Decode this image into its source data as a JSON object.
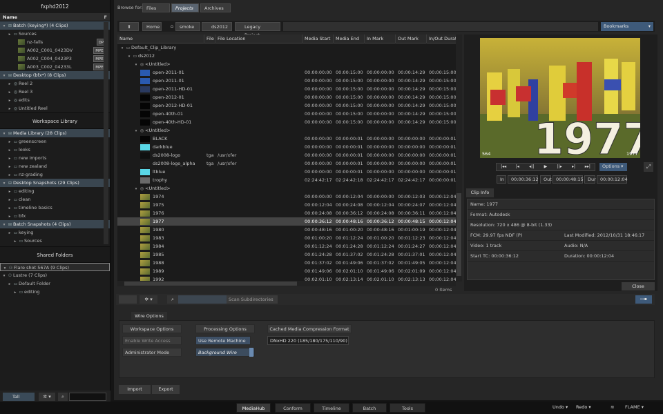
{
  "left": {
    "title": "fxphd2012",
    "col_header": "Name",
    "col_filter": "F",
    "tree": [
      {
        "indent": 0,
        "type": "grp",
        "icon": "batch-icon",
        "label": "Batch (keying*) (4 Clips)"
      },
      {
        "indent": 2,
        "type": "folder",
        "label": "Sources"
      },
      {
        "indent": 4,
        "type": "clip",
        "label": "nz-falls",
        "fmt": "DPX"
      },
      {
        "indent": 4,
        "type": "clip",
        "label": "A002_C001_0423DV",
        "fmt": "MPEG"
      },
      {
        "indent": 4,
        "type": "clip",
        "label": "A002_C004_0423P3",
        "fmt": "MPEG"
      },
      {
        "indent": 4,
        "type": "clip",
        "label": "A003_C002_04233L",
        "fmt": "MPEG"
      },
      {
        "indent": 0,
        "type": "grp",
        "icon": "desktop-icon",
        "label": "Desktop (bfx*) (8 Clips)"
      },
      {
        "indent": 2,
        "type": "reel",
        "label": "Reel 2"
      },
      {
        "indent": 2,
        "type": "reel",
        "label": "Reel 3"
      },
      {
        "indent": 2,
        "type": "reel",
        "label": "edits"
      },
      {
        "indent": 2,
        "type": "reel",
        "label": "Untitled Reel"
      }
    ],
    "section_workspace": "Workspace Library",
    "tree2": [
      {
        "indent": 0,
        "type": "grp",
        "label": "Media Library (28 Clips)"
      },
      {
        "indent": 2,
        "type": "folder",
        "label": "greenscreen"
      },
      {
        "indent": 2,
        "type": "folder",
        "label": "looks"
      },
      {
        "indent": 2,
        "type": "folder",
        "label": "new imports"
      },
      {
        "indent": 2,
        "type": "folder",
        "label": "new zealand"
      },
      {
        "indent": 2,
        "type": "folder",
        "label": "nz-grading"
      },
      {
        "indent": 0,
        "type": "grp",
        "label": "Desktop Snapshots (29 Clips)"
      },
      {
        "indent": 2,
        "type": "folder",
        "label": "editing"
      },
      {
        "indent": 2,
        "type": "folder",
        "label": "clean"
      },
      {
        "indent": 2,
        "type": "folder",
        "label": "timeline basics"
      },
      {
        "indent": 2,
        "type": "folder",
        "label": "bfx"
      },
      {
        "indent": 0,
        "type": "grp",
        "label": "Batch Snapshots (4 Clips)"
      },
      {
        "indent": 2,
        "type": "folder",
        "label": "keying"
      },
      {
        "indent": 4,
        "type": "folder",
        "label": "Sources"
      }
    ],
    "section_shared": "Shared Folders",
    "tree3": [
      {
        "indent": 0,
        "type": "share",
        "label": "Flare shot 567A (9 Clips)",
        "outlined": true
      },
      {
        "indent": 0,
        "type": "share",
        "label": "Lustre (7 Clips)"
      },
      {
        "indent": 2,
        "type": "folder",
        "label": "Default Folder"
      },
      {
        "indent": 4,
        "type": "folder",
        "label": "editing"
      }
    ],
    "bottom": {
      "view_label": "Tall"
    }
  },
  "topbar": {
    "browse_for": "Browse for:",
    "tabs": [
      "Files",
      "Projects",
      "Archives"
    ],
    "active_tab": 1,
    "home": "Home",
    "crumbs": [
      "smoke",
      "ds2012",
      "Legacy Project"
    ],
    "bookmarks": "Bookmarks"
  },
  "table": {
    "columns": [
      "Name",
      "File",
      "File Location",
      "Media Start",
      "Media End",
      "In Mark",
      "Out Mark",
      "In/Out Durati"
    ],
    "rows": [
      {
        "lvl": 0,
        "kind": "lib",
        "name": "Default_Clip_Library"
      },
      {
        "lvl": 1,
        "kind": "lib",
        "name": "ds2012"
      },
      {
        "lvl": 2,
        "kind": "reel",
        "name": "<Untitled>"
      },
      {
        "lvl": 3,
        "kind": "clip",
        "thumb": "blue",
        "name": "open-2011-01",
        "ms": "00:00:00:00",
        "me": "00:00:15:00",
        "in": "00:00:00:00",
        "out": "00:00:14:29",
        "dur": "00:00:15:00"
      },
      {
        "lvl": 3,
        "kind": "clip",
        "thumb": "blue",
        "name": "open-2011-01",
        "ms": "00:00:00:00",
        "me": "00:00:15:00",
        "in": "00:00:00:00",
        "out": "00:00:14:29",
        "dur": "00:00:15:00"
      },
      {
        "lvl": 3,
        "kind": "clip",
        "thumb": "bluegrey",
        "name": "open-2011-HD-01",
        "ms": "00:00:00:00",
        "me": "00:00:15:00",
        "in": "00:00:00:00",
        "out": "00:00:14:29",
        "dur": "00:00:15:00"
      },
      {
        "lvl": 3,
        "kind": "clip",
        "thumb": "black",
        "name": "open-2012-01",
        "ms": "00:00:00:00",
        "me": "00:00:15:00",
        "in": "00:00:00:00",
        "out": "00:00:14:29",
        "dur": "00:00:15:00"
      },
      {
        "lvl": 3,
        "kind": "clip",
        "thumb": "black",
        "name": "open-2012-HD-01",
        "ms": "00:00:00:00",
        "me": "00:00:15:00",
        "in": "00:00:00:00",
        "out": "00:00:14:29",
        "dur": "00:00:15:00"
      },
      {
        "lvl": 3,
        "kind": "clip",
        "thumb": "black",
        "name": "open-40th-01",
        "ms": "00:00:00:00",
        "me": "00:00:15:00",
        "in": "00:00:00:00",
        "out": "00:00:14:29",
        "dur": "00:00:15:00"
      },
      {
        "lvl": 3,
        "kind": "clip",
        "thumb": "black",
        "name": "open-40th-HD-01",
        "ms": "00:00:00:00",
        "me": "00:00:15:00",
        "in": "00:00:00:00",
        "out": "00:00:14:29",
        "dur": "00:00:15:00"
      },
      {
        "lvl": 2,
        "kind": "reel",
        "name": "<Untitled>"
      },
      {
        "lvl": 3,
        "kind": "clip",
        "thumb": "black",
        "name": "BLACK",
        "ms": "00:00:00:00",
        "me": "00:00:00:01",
        "in": "00:00:00:00",
        "out": "00:00:00:00",
        "dur": "00:00:00:01"
      },
      {
        "lvl": 3,
        "kind": "clip",
        "thumb": "cyan",
        "name": "darkblue",
        "ms": "00:00:00:00",
        "me": "00:00:00:01",
        "in": "00:00:00:00",
        "out": "00:00:00:00",
        "dur": "00:00:00:01"
      },
      {
        "lvl": 3,
        "kind": "clip",
        "thumb": "logo",
        "name": "ds2008-logo",
        "file": "tga",
        "loc": "/usr/xfer",
        "ms": "00:00:00:00",
        "me": "00:00:00:01",
        "in": "00:00:00:00",
        "out": "00:00:00:00",
        "dur": "00:00:00:01"
      },
      {
        "lvl": 3,
        "kind": "clip",
        "thumb": "logo2",
        "name": "ds2008-logo_alpha",
        "file": "tga",
        "loc": "/usr/xfer",
        "ms": "00:00:00:00",
        "me": "00:00:00:01",
        "in": "00:00:00:00",
        "out": "00:00:00:00",
        "dur": "00:00:00:01"
      },
      {
        "lvl": 3,
        "kind": "clip",
        "thumb": "cyan",
        "name": "ltblue",
        "ms": "00:00:00:00",
        "me": "00:00:00:01",
        "in": "00:00:00:00",
        "out": "00:00:00:00",
        "dur": "00:00:00:01"
      },
      {
        "lvl": 3,
        "kind": "clip",
        "thumb": "grey",
        "name": "trophy",
        "ms": "02:24:42:17",
        "me": "02:24:42:18",
        "in": "02:24:42:17",
        "out": "02:24:42:17",
        "dur": "00:00:00:01"
      },
      {
        "lvl": 2,
        "kind": "reel",
        "name": "<Untitled>"
      },
      {
        "lvl": 3,
        "kind": "clip",
        "thumb": "photo",
        "name": "1974",
        "ms": "00:00:00:00",
        "me": "00:00:12:04",
        "in": "00:00:00:00",
        "out": "00:00:12:03",
        "dur": "00:00:12:04"
      },
      {
        "lvl": 3,
        "kind": "clip",
        "thumb": "photo",
        "name": "1975",
        "ms": "00:00:12:04",
        "me": "00:00:24:08",
        "in": "00:00:12:04",
        "out": "00:00:24:07",
        "dur": "00:00:12:04"
      },
      {
        "lvl": 3,
        "kind": "clip",
        "thumb": "photo",
        "name": "1976",
        "ms": "00:00:24:08",
        "me": "00:00:36:12",
        "in": "00:00:24:08",
        "out": "00:00:36:11",
        "dur": "00:00:12:04"
      },
      {
        "lvl": 3,
        "kind": "clip",
        "thumb": "photo",
        "name": "1977",
        "ms": "00:00:36:12",
        "me": "00:00:48:16",
        "in": "00:00:36:12",
        "out": "00:00:48:15",
        "dur": "00:00:12:04",
        "sel": true
      },
      {
        "lvl": 3,
        "kind": "clip",
        "thumb": "photo",
        "name": "1980",
        "ms": "00:00:48:16",
        "me": "00:01:00:20",
        "in": "00:00:48:16",
        "out": "00:01:00:19",
        "dur": "00:00:12:04"
      },
      {
        "lvl": 3,
        "kind": "clip",
        "thumb": "photo",
        "name": "1983",
        "ms": "00:01:00:20",
        "me": "00:01:12:24",
        "in": "00:01:00:20",
        "out": "00:01:12:23",
        "dur": "00:00:12:04"
      },
      {
        "lvl": 3,
        "kind": "clip",
        "thumb": "photo",
        "name": "1984",
        "ms": "00:01:12:24",
        "me": "00:01:24:28",
        "in": "00:01:12:24",
        "out": "00:01:24:27",
        "dur": "00:00:12:04"
      },
      {
        "lvl": 3,
        "kind": "clip",
        "thumb": "photo",
        "name": "1985",
        "ms": "00:01:24:28",
        "me": "00:01:37:02",
        "in": "00:01:24:28",
        "out": "00:01:37:01",
        "dur": "00:00:12:04"
      },
      {
        "lvl": 3,
        "kind": "clip",
        "thumb": "photo",
        "name": "1988",
        "ms": "00:01:37:02",
        "me": "00:01:49:06",
        "in": "00:01:37:02",
        "out": "00:01:49:05",
        "dur": "00:00:12:04"
      },
      {
        "lvl": 3,
        "kind": "clip",
        "thumb": "photo",
        "name": "1989",
        "ms": "00:01:49:06",
        "me": "00:02:01:10",
        "in": "00:01:49:06",
        "out": "00:02:01:09",
        "dur": "00:00:12:04"
      },
      {
        "lvl": 3,
        "kind": "clip",
        "thumb": "photo",
        "name": "1992",
        "ms": "00:02:01:10",
        "me": "00:02:13:14",
        "in": "00:02:01:10",
        "out": "00:02:13:13",
        "dur": "00:00:12:04"
      }
    ],
    "items_count": "0 Items"
  },
  "viewer": {
    "overlay_text": "1977",
    "corner_left": "564",
    "corner_right": "1977",
    "options": "Options",
    "in_label": "In",
    "in_val": "00:00:36:12",
    "out_label": "Out",
    "out_val": "00:00:48:15",
    "dur_label": "Dur",
    "dur_val": "00:00:12:04"
  },
  "clipinfo": {
    "tab": "Clip Info",
    "name": "Name: 1977",
    "format": "Format: Autodesk",
    "resolution": "Resolution: 720 x 486 @ 8-bit (1.33)",
    "fcm": "FCM: 29.97 fps NDF (P)",
    "last_modified": "Last Modified: 2012/10/31 18:46:17",
    "video": "Video: 1 track",
    "audio": "Audio: N/A",
    "start_tc": "Start TC: 00:00:36:12",
    "duration": "Duration: 00:00:12:04",
    "close": "Close"
  },
  "toolbar2": {
    "scan": "Scan Subdirectories"
  },
  "wire": {
    "header": "Wire Options",
    "workspace_options": "Workspace Options",
    "processing_options": "Processing Options",
    "cached_media": "Cached Media Compression Format",
    "enable_write": "Enable Write Access",
    "use_remote": "Use Remote Machine",
    "codec": "DNxHD 220 (185/180/175/110/90)",
    "admin_mode": "Administrator Mode",
    "background_wire": "Background Wire"
  },
  "footer": {
    "import": "Import",
    "export": "Export",
    "tabs": [
      "MediaHub",
      "Conform",
      "Timeline",
      "Batch",
      "Tools"
    ],
    "undo": "Undo",
    "redo": "Redo",
    "app": "FLAME"
  }
}
